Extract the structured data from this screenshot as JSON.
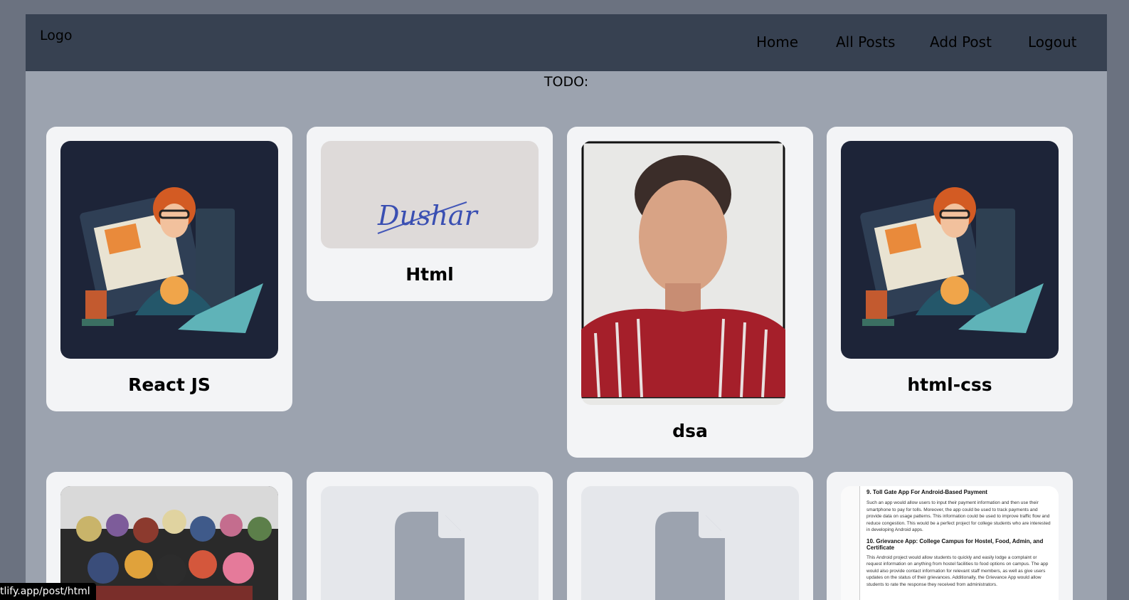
{
  "navbar": {
    "logo": "Logo",
    "links": [
      "Home",
      "All Posts",
      "Add Post",
      "Logout"
    ]
  },
  "todo_label": "TODO:",
  "posts": [
    {
      "title": "React JS",
      "image": "developer-illustration"
    },
    {
      "title": "Html",
      "image": "signature-photo",
      "signature": "Dushar"
    },
    {
      "title": "dsa",
      "image": "portrait-photo"
    },
    {
      "title": "html-css",
      "image": "developer-illustration"
    },
    {
      "title": "",
      "image": "anime-characters-collage"
    },
    {
      "title": "",
      "image": "file-placeholder-icon"
    },
    {
      "title": "",
      "image": "file-placeholder-icon"
    },
    {
      "title": "",
      "image": "document-screenshot",
      "doc": {
        "h1": "9. Toll Gate App For Android-Based Payment",
        "p1": "Such an app would allow users to input their payment information and then use their smartphone to pay for tolls. Moreover, the app could be used to track payments and provide data on usage patterns. This information could be used to improve traffic flow and reduce congestion. This would be a perfect project for college students who are interested in developing Android apps.",
        "h2": "10. Grievance App: College Campus for Hostel, Food, Admin, and Certificate",
        "p2": "This Android project would allow students to quickly and easily lodge a complaint or request information on anything from hostel facilities to food options on campus. The app would also provide contact information for relevant staff members, as well as give users updates on the status of their grievances. Additionally, the Grievance App would allow students to rate the response they received from administrators."
      }
    }
  ],
  "status_url": "tlify.app/post/html",
  "colors": {
    "page": "#6b7280",
    "navbar": "#374151",
    "content": "#9ca3af",
    "card": "#f3f4f6"
  }
}
